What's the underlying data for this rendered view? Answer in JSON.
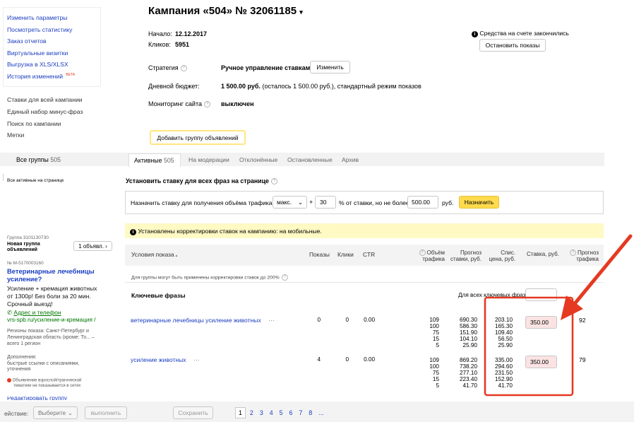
{
  "sidebar": {
    "menu1": [
      "Изменить параметры",
      "Посмотреть статистику",
      "Заказ отчетов",
      "Виртуальные визитки",
      "Выгрузка в XLS/XLSX",
      "История изменений"
    ],
    "beta": "BETA",
    "menu2": [
      "Ставки для всей кампании",
      "Единый набор минус-фраз",
      "Поиск по кампании",
      "Метки"
    ]
  },
  "header": {
    "title": "Кампания «504» № 32061185",
    "start_label": "Начало:",
    "start_value": "12.12.2017",
    "clicks_label": "Кликов:",
    "clicks_value": "5951",
    "funds_notice": "Средства на счете закончились",
    "stop_button": "Остановить показы"
  },
  "settings": {
    "strategy_label": "Стратегия",
    "strategy_value": "Ручное управление ставками",
    "change_button": "Изменить",
    "budget_label": "Дневной бюджет:",
    "budget_value": "1 500.00 руб.",
    "budget_note": "(осталось 1 500.00 руб.), стандартный режим показов",
    "monitoring_label": "Мониторинг сайта",
    "monitoring_value": "выключен",
    "add_group_button": "Добавить группу объявлений"
  },
  "tabs": {
    "all_groups": "Все группы",
    "all_groups_count": "505",
    "items": [
      {
        "label": "Активные",
        "count": "505"
      },
      {
        "label": "На модерации"
      },
      {
        "label": "Отклонённые"
      },
      {
        "label": "Остановленные"
      },
      {
        "label": "Архив"
      }
    ]
  },
  "left_panel": {
    "all_active": "Все активные на странице",
    "group_id": "Группа 3101130730",
    "group_name_1": "Новая группа",
    "group_name_2": "объявлений",
    "ads_count_button": "1 объявл.  ›",
    "ad_id": "№ M-5170003160",
    "ad_title_1": "Ветеринарные лечебницы",
    "ad_title_2": "усиление?",
    "ad_text_1": "Усиление + кремация животных",
    "ad_text_2": "от 1300р! Без боли за 20 мин.",
    "ad_text_3": "Срочный выезд!",
    "address_link": "Адрес и телефон",
    "url": "vrs-spb.ru/усиление-и-кремация /",
    "regions_1": "Регионы показа: Санкт-Петербург и",
    "regions_2": "Ленинградская область (кроме: То... –",
    "regions_3": "всего 1 регион",
    "extras_1": "Дополнения:",
    "extras_2": "быстрые ссылки с описаниями,",
    "extras_3": "уточнения",
    "warning_1": "Объявление взрослой/трагической",
    "warning_2": "тематики не показывается в сетях",
    "edit_group": "Редактировать группу"
  },
  "bid_panel": {
    "title": "Установить ставку для всех фраз на странице",
    "prefix": "Назначить ставку для получения объёма трафика",
    "select_value": "макс.",
    "plus": "+",
    "percent_value": "30",
    "middle": "% от ставки, но не более",
    "limit_value": "500.00",
    "currency": "руб.",
    "apply_button": "Назначить"
  },
  "notice": "Установлены корректировки ставок на кампанию: на мобильные.",
  "table": {
    "headers": {
      "conditions": "Условия показа",
      "impressions": "Показы",
      "clicks": "Клики",
      "ctr": "CTR",
      "volume_1": "Объём",
      "volume_2": "трафика",
      "forecast_bid_1": "Прогноз",
      "forecast_bid_2": "ставки, руб.",
      "charge_1": "Спис.",
      "charge_2": "цена, руб.",
      "bid": "Ставка, руб.",
      "forecast_traffic_1": "Прогноз",
      "forecast_traffic_2": "трафика"
    },
    "group_note": "Для группы могут быть применены корректировки ставок до 200%",
    "keywords_label": "Ключевые фразы",
    "all_keywords_label": "Для всех ключевых фраз:",
    "rows": [
      {
        "phrase": "ветеринарные лечебницы усиление животных",
        "dots": "···",
        "impressions": "0",
        "clicks": "0",
        "ctr": "0.00",
        "volume": [
          "109",
          "100",
          "75",
          "15",
          "5"
        ],
        "forecast": [
          "690.30",
          "586.30",
          "151.90",
          "104.10",
          "25.90"
        ],
        "charge": [
          "203.10",
          "165.30",
          "109.40",
          "56.50",
          "25.90"
        ],
        "bid": "350.00",
        "traffic": "92"
      },
      {
        "phrase": "усиление животных",
        "dots": "···",
        "impressions": "4",
        "clicks": "0",
        "ctr": "0.00",
        "volume": [
          "109",
          "100",
          "75",
          "15",
          "5"
        ],
        "forecast": [
          "869.20",
          "738.20",
          "277.10",
          "223.40",
          "41.70"
        ],
        "charge": [
          "335.00",
          "294.60",
          "231.50",
          "152.90",
          "41.70"
        ],
        "bid": "350.00",
        "traffic": "79"
      }
    ]
  },
  "bottom": {
    "action_label": "ействие:",
    "select_label": "Выберите",
    "run_button": "выполнить",
    "save_button": "Сохранить",
    "pages": [
      "1",
      "2",
      "3",
      "4",
      "5",
      "6",
      "7",
      "8",
      "..."
    ]
  },
  "colors": {
    "link": "#1a3dc1",
    "yellow_button": "#ffdb4d",
    "notice_bg": "#fff9c4",
    "annotation_red": "#e53922",
    "bid_input_bg": "#fbe3e3"
  }
}
